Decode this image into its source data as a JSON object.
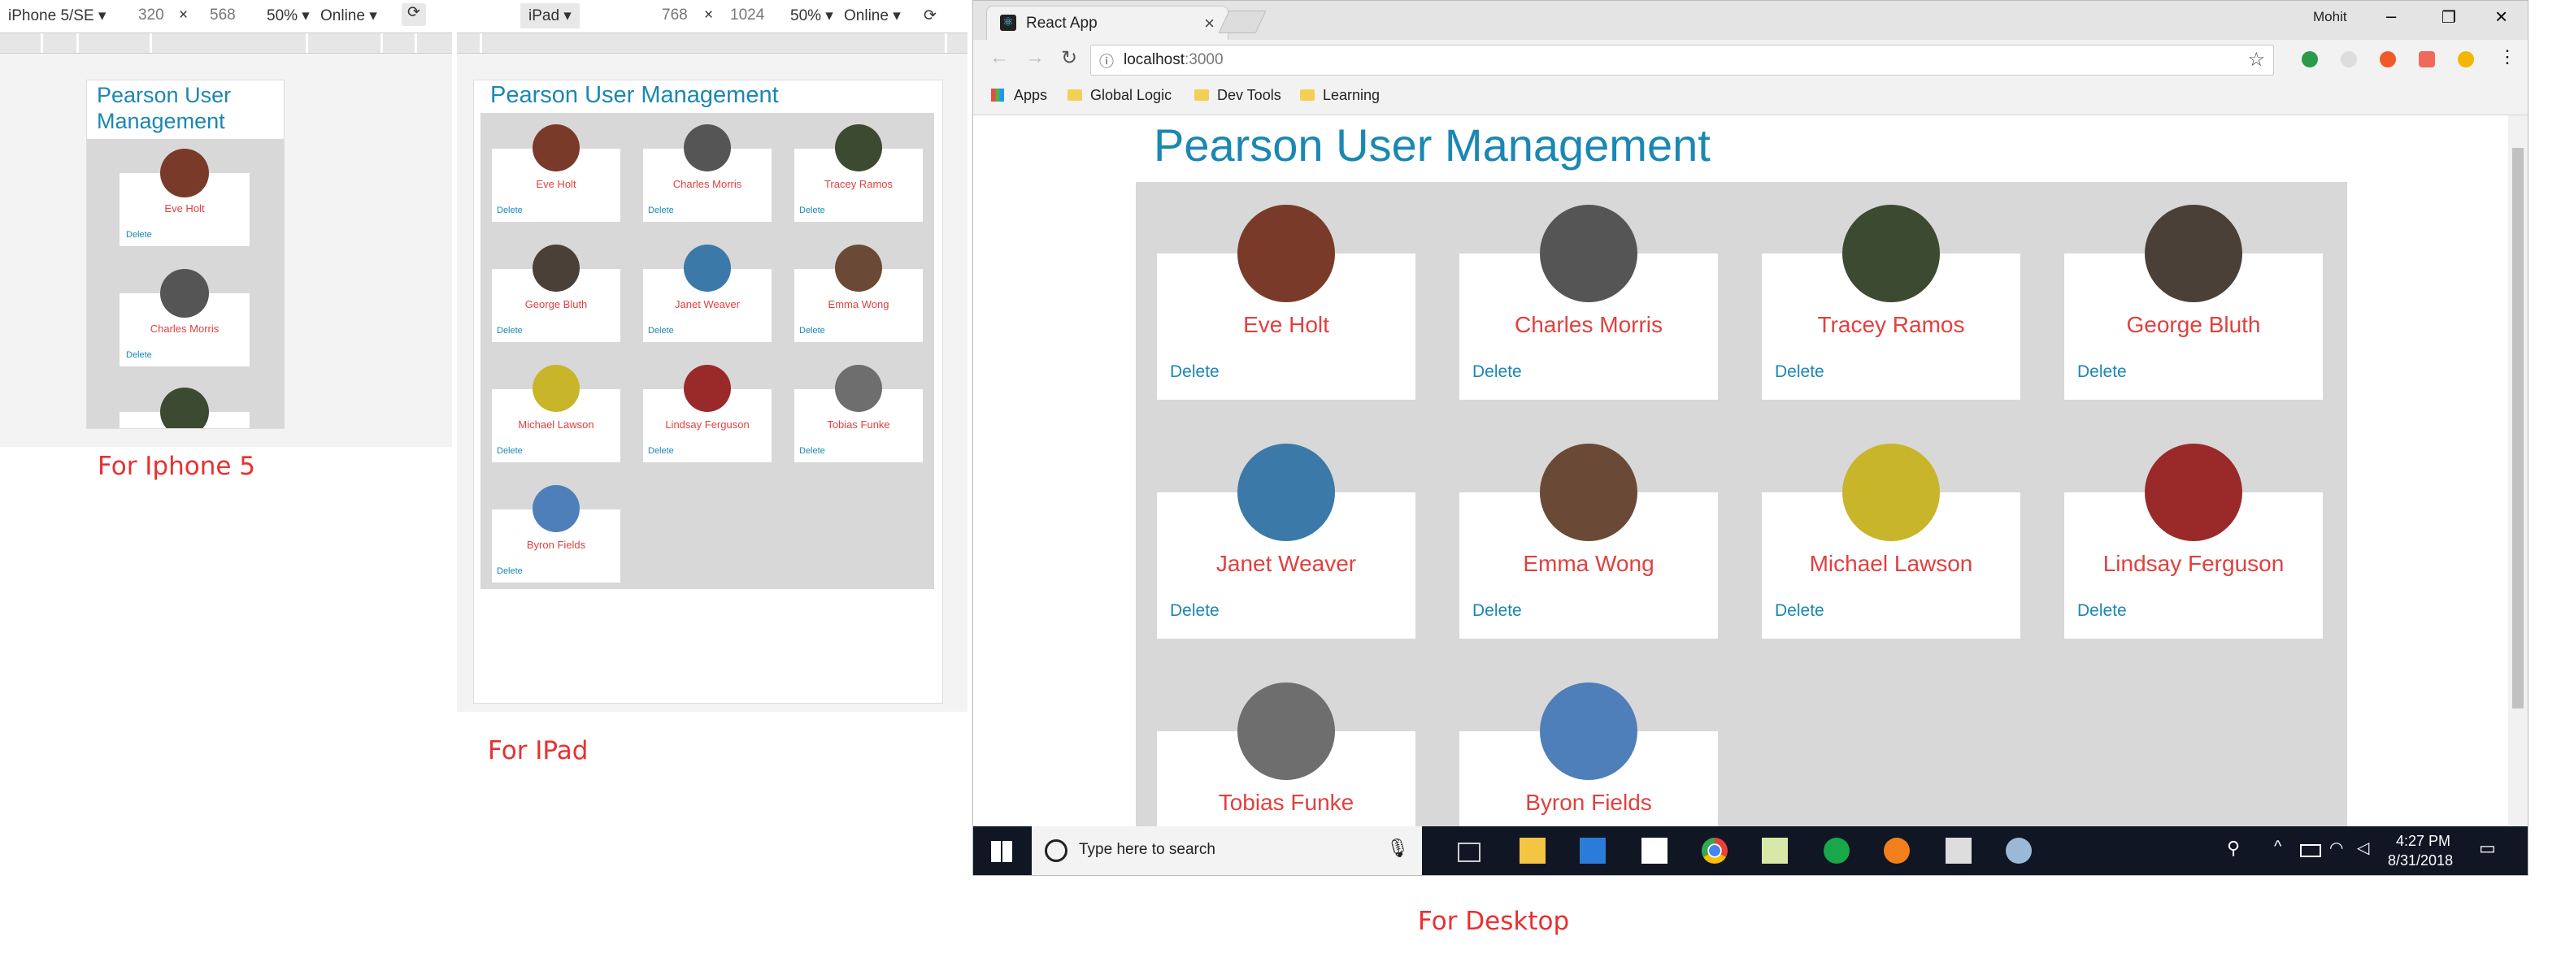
{
  "app": {
    "title": "Pearson User Management",
    "title_two_line": [
      "Pearson User",
      "Management"
    ],
    "delete_label": "Delete",
    "users": [
      {
        "name": "Eve Holt",
        "color": "#7a3a2a"
      },
      {
        "name": "Charles Morris",
        "color": "#555555"
      },
      {
        "name": "Tracey Ramos",
        "color": "#3d4a32"
      },
      {
        "name": "George Bluth",
        "color": "#4a4038"
      },
      {
        "name": "Janet Weaver",
        "color": "#3b79a8"
      },
      {
        "name": "Emma Wong",
        "color": "#6a4a36"
      },
      {
        "name": "Michael Lawson",
        "color": "#c8b52a"
      },
      {
        "name": "Lindsay Ferguson",
        "color": "#9a2a2a"
      },
      {
        "name": "Tobias Funke",
        "color": "#6e6e6e"
      },
      {
        "name": "Byron Fields",
        "color": "#4e7fb8"
      }
    ]
  },
  "iphone_toolbar": {
    "device": "iPhone 5/SE",
    "width": "320",
    "x": "×",
    "height": "568",
    "zoom": "50%",
    "network": "Online"
  },
  "ipad_toolbar": {
    "device": "iPad",
    "width": "768",
    "x": "×",
    "height": "1024",
    "zoom": "50%",
    "network": "Online"
  },
  "captions": {
    "iphone": "For Iphone 5",
    "ipad": "For IPad",
    "desktop": "For Desktop"
  },
  "browser": {
    "tab_title": "React App",
    "url_host": "localhost",
    "url_port": ":3000",
    "profile": "Mohit",
    "bookmarks": {
      "apps": "Apps",
      "b1": "Global Logic",
      "b2": "Dev Tools",
      "b3": "Learning"
    }
  },
  "taskbar": {
    "search_placeholder": "Type here to search",
    "time": "4:27 PM",
    "date": "8/31/2018"
  },
  "colors": {
    "title_blue": "#1b87b3",
    "name_red": "#e0413f",
    "caption_red": "#ea2f2f",
    "grid_gray": "#d8d8d8"
  }
}
